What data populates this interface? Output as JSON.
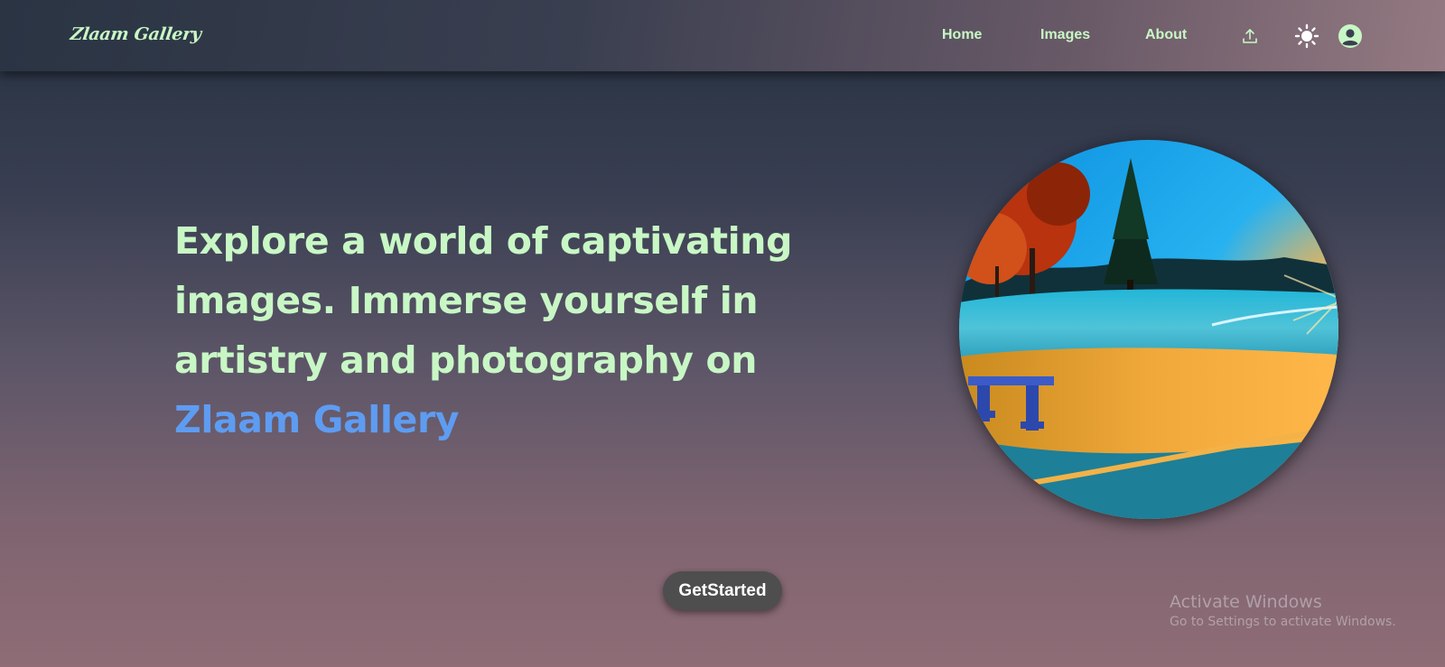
{
  "navbar": {
    "logo": "Zlaam Gallery",
    "links": [
      "Home",
      "Images",
      "About"
    ],
    "icons": [
      "upload-icon",
      "sun-icon",
      "user-icon"
    ]
  },
  "hero": {
    "headline": "Explore a world of captivating images. Immerse yourself in artistry and photography on",
    "brand": "Zlaam Gallery",
    "image": "circular landscape photo of park with bench, autumn trees and sunset",
    "cta_label": "GetStarted"
  },
  "os_overlay": {
    "title": "Activate Windows",
    "subtitle": "Go to Settings to activate Windows."
  },
  "colors": {
    "text_accent": "#c8f7c5",
    "brand_blue": "#5e9cf2",
    "button_bg": "#4e4e4e"
  }
}
